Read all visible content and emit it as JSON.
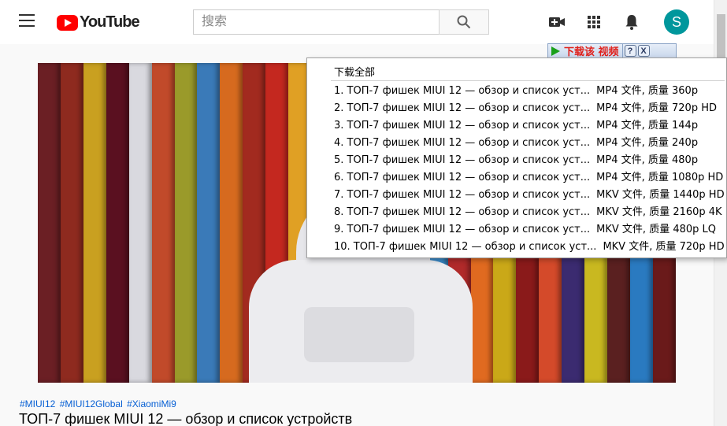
{
  "header": {
    "logo_text": "YouTube",
    "search_placeholder": "搜索",
    "avatar_letter": "S"
  },
  "video": {
    "hashtags": [
      "#MIUI12",
      "#MIUI12Global",
      "#XiaomiMi9"
    ],
    "title": "ТОП-7 фишек MIUI 12 — обзор и список устройств"
  },
  "download_bar": {
    "label": "下载该 视频",
    "help_label": "?",
    "close_label": "X"
  },
  "download_menu": {
    "all_label": "下载全部",
    "items": [
      {
        "label": "1.  ТОП-7 фишек MIUI 12 — обзор и список уст...",
        "format": "MP4 文件, 质量 360p"
      },
      {
        "label": "2.  ТОП-7 фишек MIUI 12 — обзор и список уст...",
        "format": "MP4 文件, 质量 720p HD"
      },
      {
        "label": "3.  ТОП-7 фишек MIUI 12 — обзор и список уст...",
        "format": "MP4 文件, 质量 144p"
      },
      {
        "label": "4.  ТОП-7 фишек MIUI 12 — обзор и список уст...",
        "format": "MP4 文件, 质量 240p"
      },
      {
        "label": "5.  ТОП-7 фишек MIUI 12 — обзор и список уст...",
        "format": "MP4 文件, 质量 480p"
      },
      {
        "label": "6.  ТОП-7 фишек MIUI 12 — обзор и список уст...",
        "format": "MP4 文件, 质量 1080p HD"
      },
      {
        "label": "7.  ТОП-7 фишек MIUI 12 — обзор и список уст...",
        "format": "MKV 文件, 质量 1440p HD"
      },
      {
        "label": "8.  ТОП-7 фишек MIUI 12 — обзор и список уст...",
        "format": "MKV 文件, 质量 2160p 4K"
      },
      {
        "label": "9.  ТОП-7 фишек MIUI 12 — обзор и список уст...",
        "format": "MKV 文件, 质量 480p LQ"
      },
      {
        "label": "10.  ТОП-7 фишек MIUI 12 — обзор и список уст...",
        "format": "MKV 文件, 质量 720p HD"
      }
    ]
  },
  "icons": {
    "menu": "hamburger-icon",
    "search": "magnifier-icon",
    "create": "video-camera-plus-icon",
    "apps": "grid-icon",
    "notifications": "bell-icon"
  },
  "colors": {
    "brand_red": "#ff0000",
    "avatar_bg": "#00979c",
    "hashtag_link": "#065fd4",
    "download_label": "#e0201a"
  }
}
